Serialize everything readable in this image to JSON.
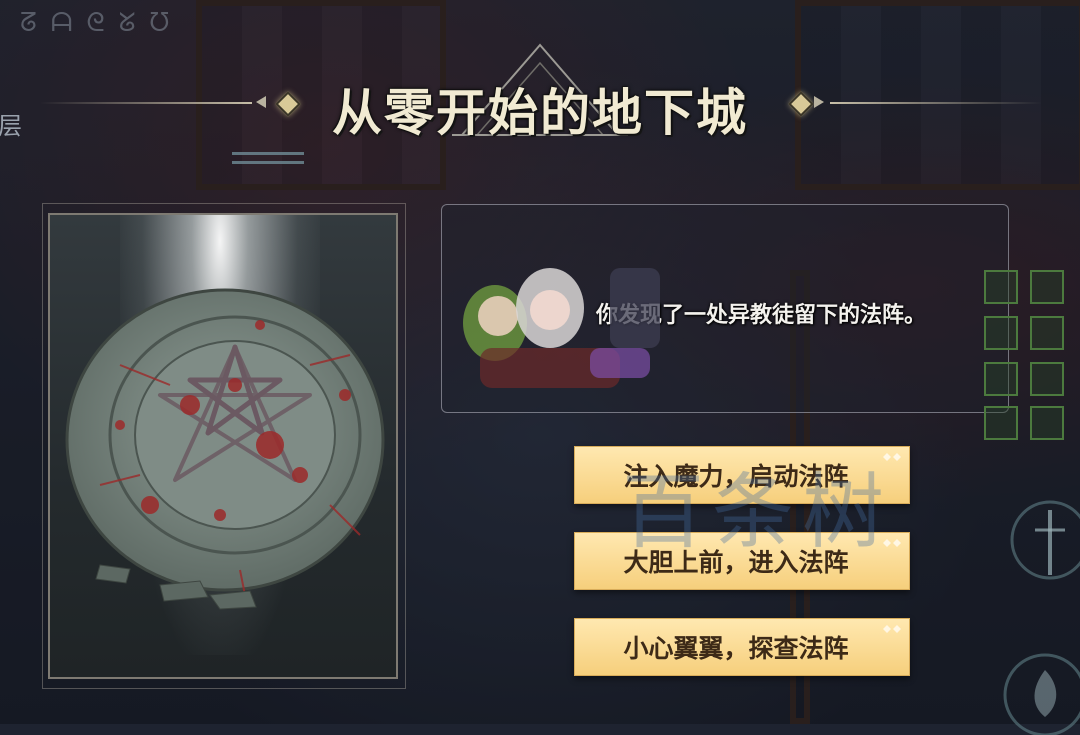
{
  "title": "从零开始的地下城",
  "side_label": "层",
  "runes": "ᘔᗩᘓᘜᘮ",
  "event": {
    "illustration_icon": "blood-pentagram-magic-circle",
    "description": "你发现了一处异教徒留下的法阵。"
  },
  "choices": [
    {
      "label": "注入魔力，启动法阵"
    },
    {
      "label": "大胆上前，进入法阵"
    },
    {
      "label": "小心翼翼，探查法阵"
    }
  ],
  "watermark": "百条树",
  "colors": {
    "title": "#f1ead2",
    "button_bg": "#f6cf7c",
    "button_text": "#3d2a17",
    "blood": "#9c2a2a"
  }
}
